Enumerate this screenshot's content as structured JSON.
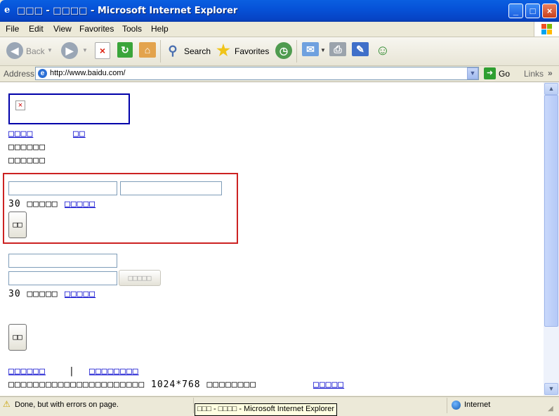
{
  "window": {
    "title": "□□□ - □□□□ - Microsoft Internet Explorer",
    "icon": "ie-icon",
    "controls": {
      "minimize": "_",
      "maximize": "□",
      "close": "×"
    }
  },
  "menu": [
    "File",
    "Edit",
    "View",
    "Favorites",
    "Tools",
    "Help"
  ],
  "toolbar": {
    "back": "Back",
    "search": "Search",
    "favorites": "Favorites"
  },
  "address": {
    "label": "Address",
    "url": "http://www.baidu.com/",
    "go": "Go",
    "links": "Links",
    "chevron": "»"
  },
  "page": {
    "broken_image": "×",
    "nav_link_1": "□□□□",
    "nav_link_2": "□□",
    "text_line_1": "□□□□□□",
    "text_line_2": "□□□□□□",
    "form1": {
      "input1_value": "",
      "input2_value": "",
      "note_prefix": "30 □□□□□",
      "note_link": "□□□□□",
      "submit": "□□"
    },
    "form2": {
      "input1_value": "",
      "input2_value": "",
      "side_button": "□□□□□",
      "note_prefix": "30 □□□□□",
      "note_link": "□□□□□",
      "submit": "□□"
    },
    "footer_link_1": "□□□□□□",
    "footer_sep": "|",
    "footer_link_2": "□□□□□□□□",
    "footer_text": "□□□□□□□□□□□□□□□□□□□□□□ 1024*768 □□□□□□□□",
    "footer_link_3": "□□□□□"
  },
  "status": {
    "text": "Done, but with errors on page.",
    "tooltip": "□□□ - □□□□ - Microsoft Internet Explorer",
    "zone": "Internet"
  },
  "colors": {
    "titlebar": "#0652d8",
    "link": "#0000cc",
    "highlight_red": "#cc2222",
    "image_border": "#0000aa"
  }
}
